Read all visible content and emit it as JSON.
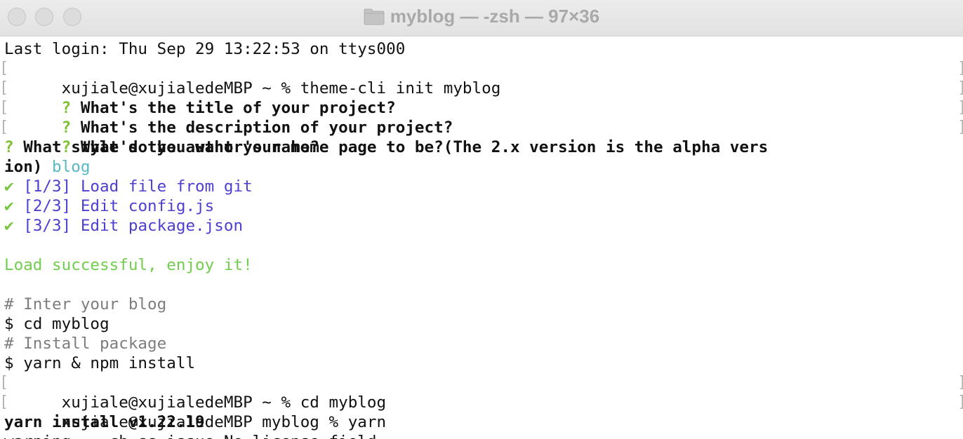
{
  "window": {
    "title": "myblog — -zsh — 97×36"
  },
  "terminal": {
    "lines": {
      "l0": "Last login: Thu Sep 29 13:22:53 on ttys000",
      "l1": "xujiale@xujialedeMBP ~ % theme-cli init myblog",
      "l2_mark": "?",
      "l2": " What's the title of your project?",
      "l3_mark": "?",
      "l3": " What's the description of your project?",
      "l4_mark": "?",
      "l4": " What's the author's name?",
      "l5_mark": "?",
      "l5": " What style do you want your home page to be?(The 2.x version is the alpha vers",
      "l6": "ion) ",
      "l6_answer": "blog",
      "l7_check": "✔",
      "l7": " [1/3] Load file from git",
      "l8_check": "✔",
      "l8": " [2/3] Edit config.js",
      "l9_check": "✔",
      "l9": " [3/3] Edit package.json",
      "l11": "Load successful, enjoy it!",
      "l13": "# Inter your blog",
      "l14": "$ cd myblog",
      "l15": "# Install package",
      "l16": "$ yarn & npm install",
      "l17": "xujiale@xujialedeMBP ~ % cd myblog",
      "l18": "xujiale@xujialedeMBP myblog % yarn",
      "l19": "yarn install v1.22.19",
      "l20": "warning ...ch-ss issue No license field"
    },
    "bracket_left": "[",
    "bracket_right": "]"
  },
  "colors": {
    "question_mark": "#7fbf33",
    "check": "#74c63b",
    "step_text": "#4c3fd1",
    "success": "#6fce4b",
    "comment": "#7d7d7d",
    "answer": "#59b8c4"
  },
  "icons": {
    "title_folder": "folder-icon"
  }
}
